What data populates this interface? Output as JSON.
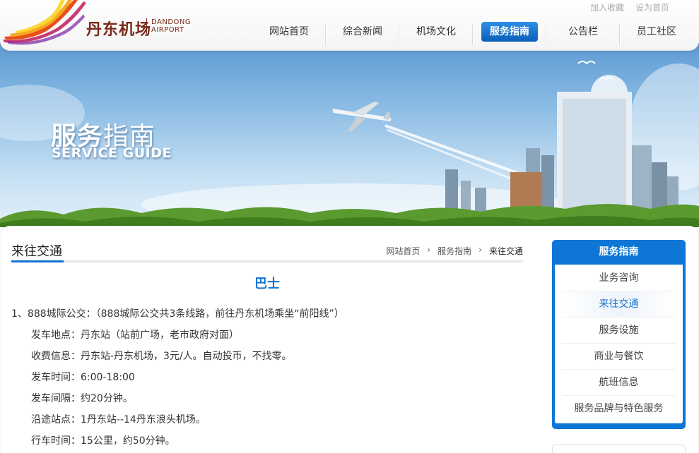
{
  "header": {
    "logo_cn": "丹东机场",
    "logo_en_1": "DANDONG",
    "logo_en_2": "AIRPORT",
    "toplinks": [
      "加入收藏",
      "设为首页"
    ],
    "nav": [
      "网站首页",
      "综合新闻",
      "机场文化",
      "服务指南",
      "公告栏",
      "员工社区"
    ],
    "nav_active": "服务指南"
  },
  "banner": {
    "title_bold": "服务",
    "title_thin": "指南",
    "subtitle": "SERVICE GUIDE"
  },
  "section": {
    "title": "来往交通",
    "breadcrumb": [
      "网站首页",
      "服务指南",
      "来往交通"
    ]
  },
  "article": {
    "heading": "巴士",
    "lines": [
      "1、888城际公交：（888城际公交共3条线路，前往丹东机场乘坐“前阳线”）",
      "发车地点：丹东站（站前广场，老市政府对面）",
      "收费信息：丹东站-丹东机场，3元/人。自动投币，不找零。",
      "发车时间：6:00-18:00",
      "发车间隔：约20分钟。",
      "沿途站点：1丹东站--14丹东浪头机场。",
      "行车时间：15公里，约50分钟。"
    ]
  },
  "sidebar": {
    "title": "服务指南",
    "items": [
      "业务咨询",
      "来往交通",
      "服务设施",
      "商业与餐饮",
      "航班信息",
      "服务品牌与特色服务"
    ],
    "active": "来往交通"
  },
  "colors": {
    "accent": "#1173d4",
    "brand_brown": "#7a2a1a"
  }
}
